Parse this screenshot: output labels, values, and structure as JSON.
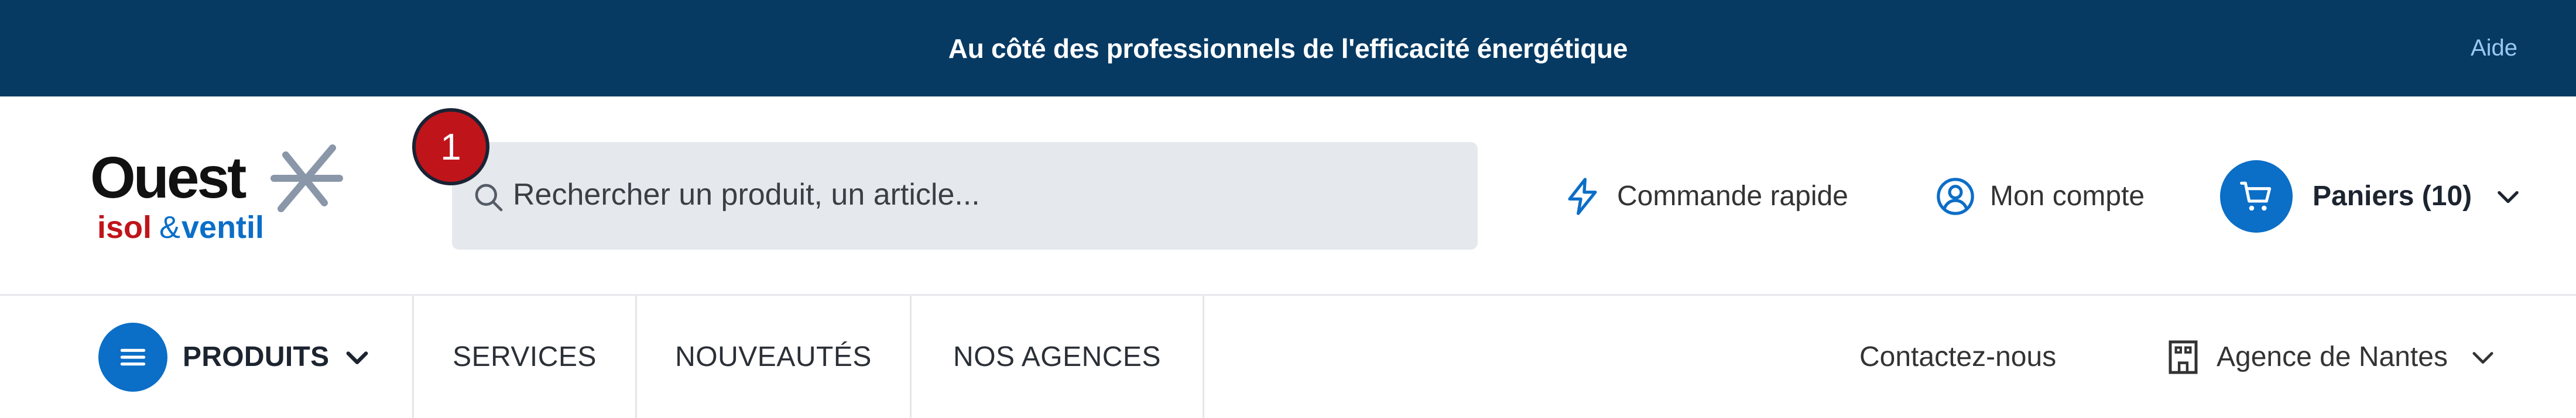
{
  "topbar": {
    "message": "Au côté des professionnels de l'efficacité énergétique",
    "help_label": "Aide"
  },
  "brand": {
    "logo_word": "Ouest",
    "logo_isol": "isol",
    "logo_amp": "&",
    "logo_ventil": "ventil",
    "colors": {
      "navy": "#063a63",
      "red": "#c0141b",
      "blue": "#0b6ec7",
      "gray": "#8a97a8"
    }
  },
  "search": {
    "placeholder": "Rechercher un produit, un article...",
    "value": "",
    "step_badge": "1"
  },
  "header": {
    "quick_order_label": "Commande rapide",
    "quick_order_icon": "lightning-icon",
    "account_label": "Mon compte",
    "account_icon": "user-circle-icon",
    "carts_label": "Paniers (10)",
    "carts_icon": "cart-icon"
  },
  "nav": {
    "products_label": "PRODUITS",
    "items": [
      {
        "label": "SERVICES"
      },
      {
        "label": "NOUVEAUTÉS"
      },
      {
        "label": "NOS AGENCES"
      }
    ],
    "contact_label": "Contactez-nous",
    "agency_label": "Agence de Nantes",
    "agency_icon": "building-icon"
  }
}
